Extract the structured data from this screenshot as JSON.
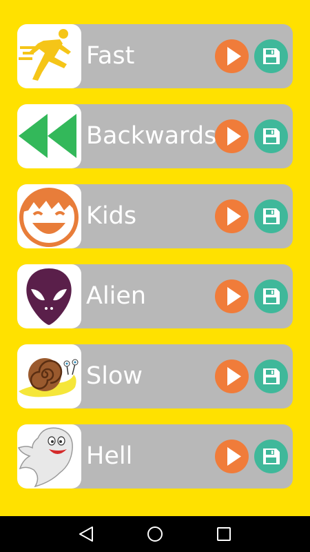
{
  "colors": {
    "background": "#ffe100",
    "row": "#b8b8b8",
    "play": "#f07c3a",
    "save": "#3fb89a",
    "navbar": "#000000"
  },
  "effects": [
    {
      "label": "Fast",
      "icon": "running-man-icon"
    },
    {
      "label": "Backwards",
      "icon": "rewind-icon"
    },
    {
      "label": "Kids",
      "icon": "kid-face-icon"
    },
    {
      "label": "Alien",
      "icon": "alien-head-icon"
    },
    {
      "label": "Slow",
      "icon": "snail-icon"
    },
    {
      "label": "Hell",
      "icon": "ghost-icon"
    }
  ],
  "navbar": {
    "back_icon": "back-triangle-icon",
    "home_icon": "home-circle-icon",
    "recents_icon": "recents-square-icon"
  }
}
